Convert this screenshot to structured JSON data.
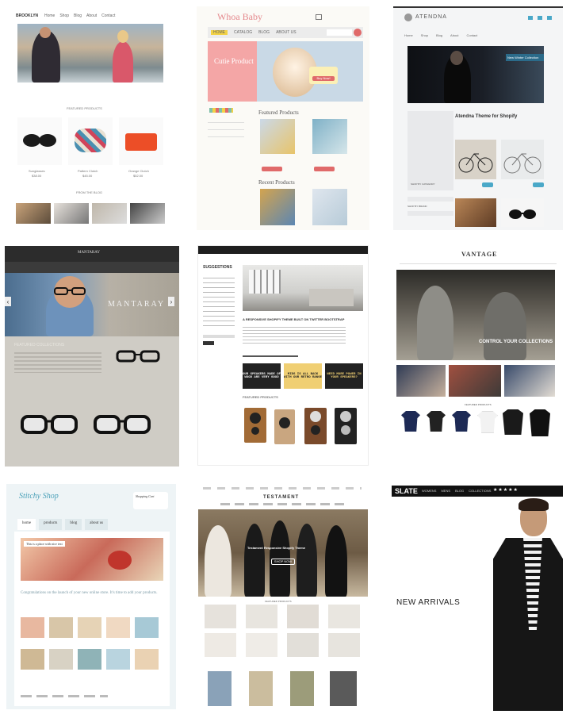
{
  "t1": {
    "brand": "BROOKLYN",
    "nav": [
      "Home",
      "Shop",
      "Blog",
      "About",
      "Contact"
    ],
    "section": "FEATURED PRODUCTS",
    "products": [
      {
        "name": "Sunglasses",
        "price": "$38.00"
      },
      {
        "name": "Pattern Clutch",
        "price": "$45.00"
      },
      {
        "name": "Orange Clutch",
        "price": "$52.00"
      }
    ],
    "section2": "FROM THE BLOG"
  },
  "t2": {
    "logo": "Whoa Baby",
    "nav": [
      "HOME",
      "CATALOG",
      "BLOG",
      "ABOUT US"
    ],
    "hero_text": "Cutie Product",
    "hero_badge": "Buy Now!",
    "featured": "Featured Products",
    "recent": "Recent Products"
  },
  "t3": {
    "logo": "ATENDNA",
    "nav": [
      "Home",
      "Shop",
      "Blog",
      "About",
      "Contact"
    ],
    "hero_caption": "New Winter Collection",
    "title": "Atendna Theme for Shopify",
    "sidebar": [
      "SHOP BY CATEGORY",
      "SHOP BY BRAND"
    ]
  },
  "t4": {
    "logo": "MANTARAY",
    "tagline": "FEATURED COLLECTIONS",
    "prev": "‹",
    "next": "›"
  },
  "t5": {
    "logo": "SUGGESTIONS",
    "headline": "A RESPONSIVE SHOPIFY THEME BUILT ON TWITTER BOOTSTRAP",
    "promos": [
      {
        "text": "OUR SPEAKERS MADE OF WOOD ARE VERY GOOD"
      },
      {
        "text": "MIDS IS ALL BACK WITH OUR RETRO RANGE"
      },
      {
        "text": "NEED MORE POWER IN YOUR SPEAKERS?"
      }
    ],
    "section": "FEATURED PRODUCTS"
  },
  "t6": {
    "logo": "VANTAGE",
    "hero_text": "CONTROL YOUR COLLECTIONS",
    "section": "FEATURED PRODUCTS"
  },
  "t7": {
    "logo": "Stitchy Shop",
    "cart": "Shopping Cart",
    "tabs": [
      "home",
      "products",
      "blog",
      "about us"
    ],
    "banner": "This is a place with nice text",
    "intro": "Congratulations on the launch of your new online store. It's time to add your products."
  },
  "t8": {
    "logo": "TESTAMENT",
    "hero_text": "Testament Responsive Shopify Theme",
    "hero_btn": "SHOP NOW",
    "section": "FEATURED PRODUCTS"
  },
  "t9": {
    "logo": "SLATE",
    "nav": [
      "WOMENS",
      "MENS",
      "BLOG",
      "COLLECTIONS"
    ],
    "stars": "★★★★★",
    "headline": "NEW ARRIVALS"
  }
}
